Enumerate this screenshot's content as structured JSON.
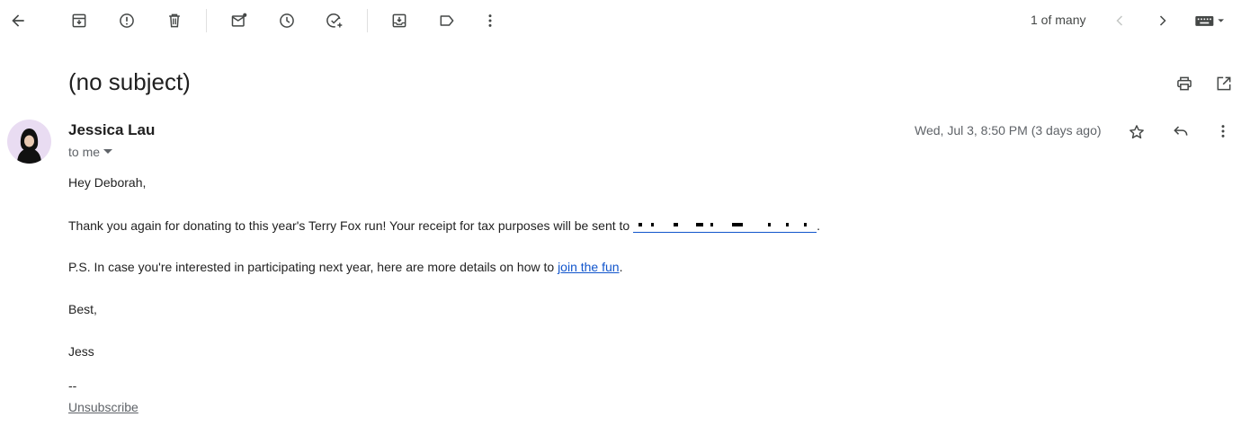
{
  "toolbar": {
    "count_label": "1 of many"
  },
  "email": {
    "subject": "(no subject)",
    "sender_name": "Jessica Lau",
    "recipient_label": "to me",
    "date": "Wed, Jul 3, 8:50 PM (3 days ago)",
    "greeting": "Hey Deborah,",
    "paragraph1_text": "Thank you again for donating to this year's Terry Fox run! Your receipt for tax purposes will be sent to ",
    "paragraph1_end": ".",
    "paragraph2_text": "P.S. In case you're interested in participating next year, here are more details on how to ",
    "paragraph2_link": "join the fun",
    "paragraph2_end": ".",
    "closing": "Best,",
    "signature": "Jess",
    "separator": "--",
    "unsubscribe_label": "Unsubscribe"
  },
  "colors": {
    "link": "#1155cc",
    "muted_text": "#5f6368",
    "body_text": "#222222",
    "avatar_bg": "#e9dcf2"
  }
}
